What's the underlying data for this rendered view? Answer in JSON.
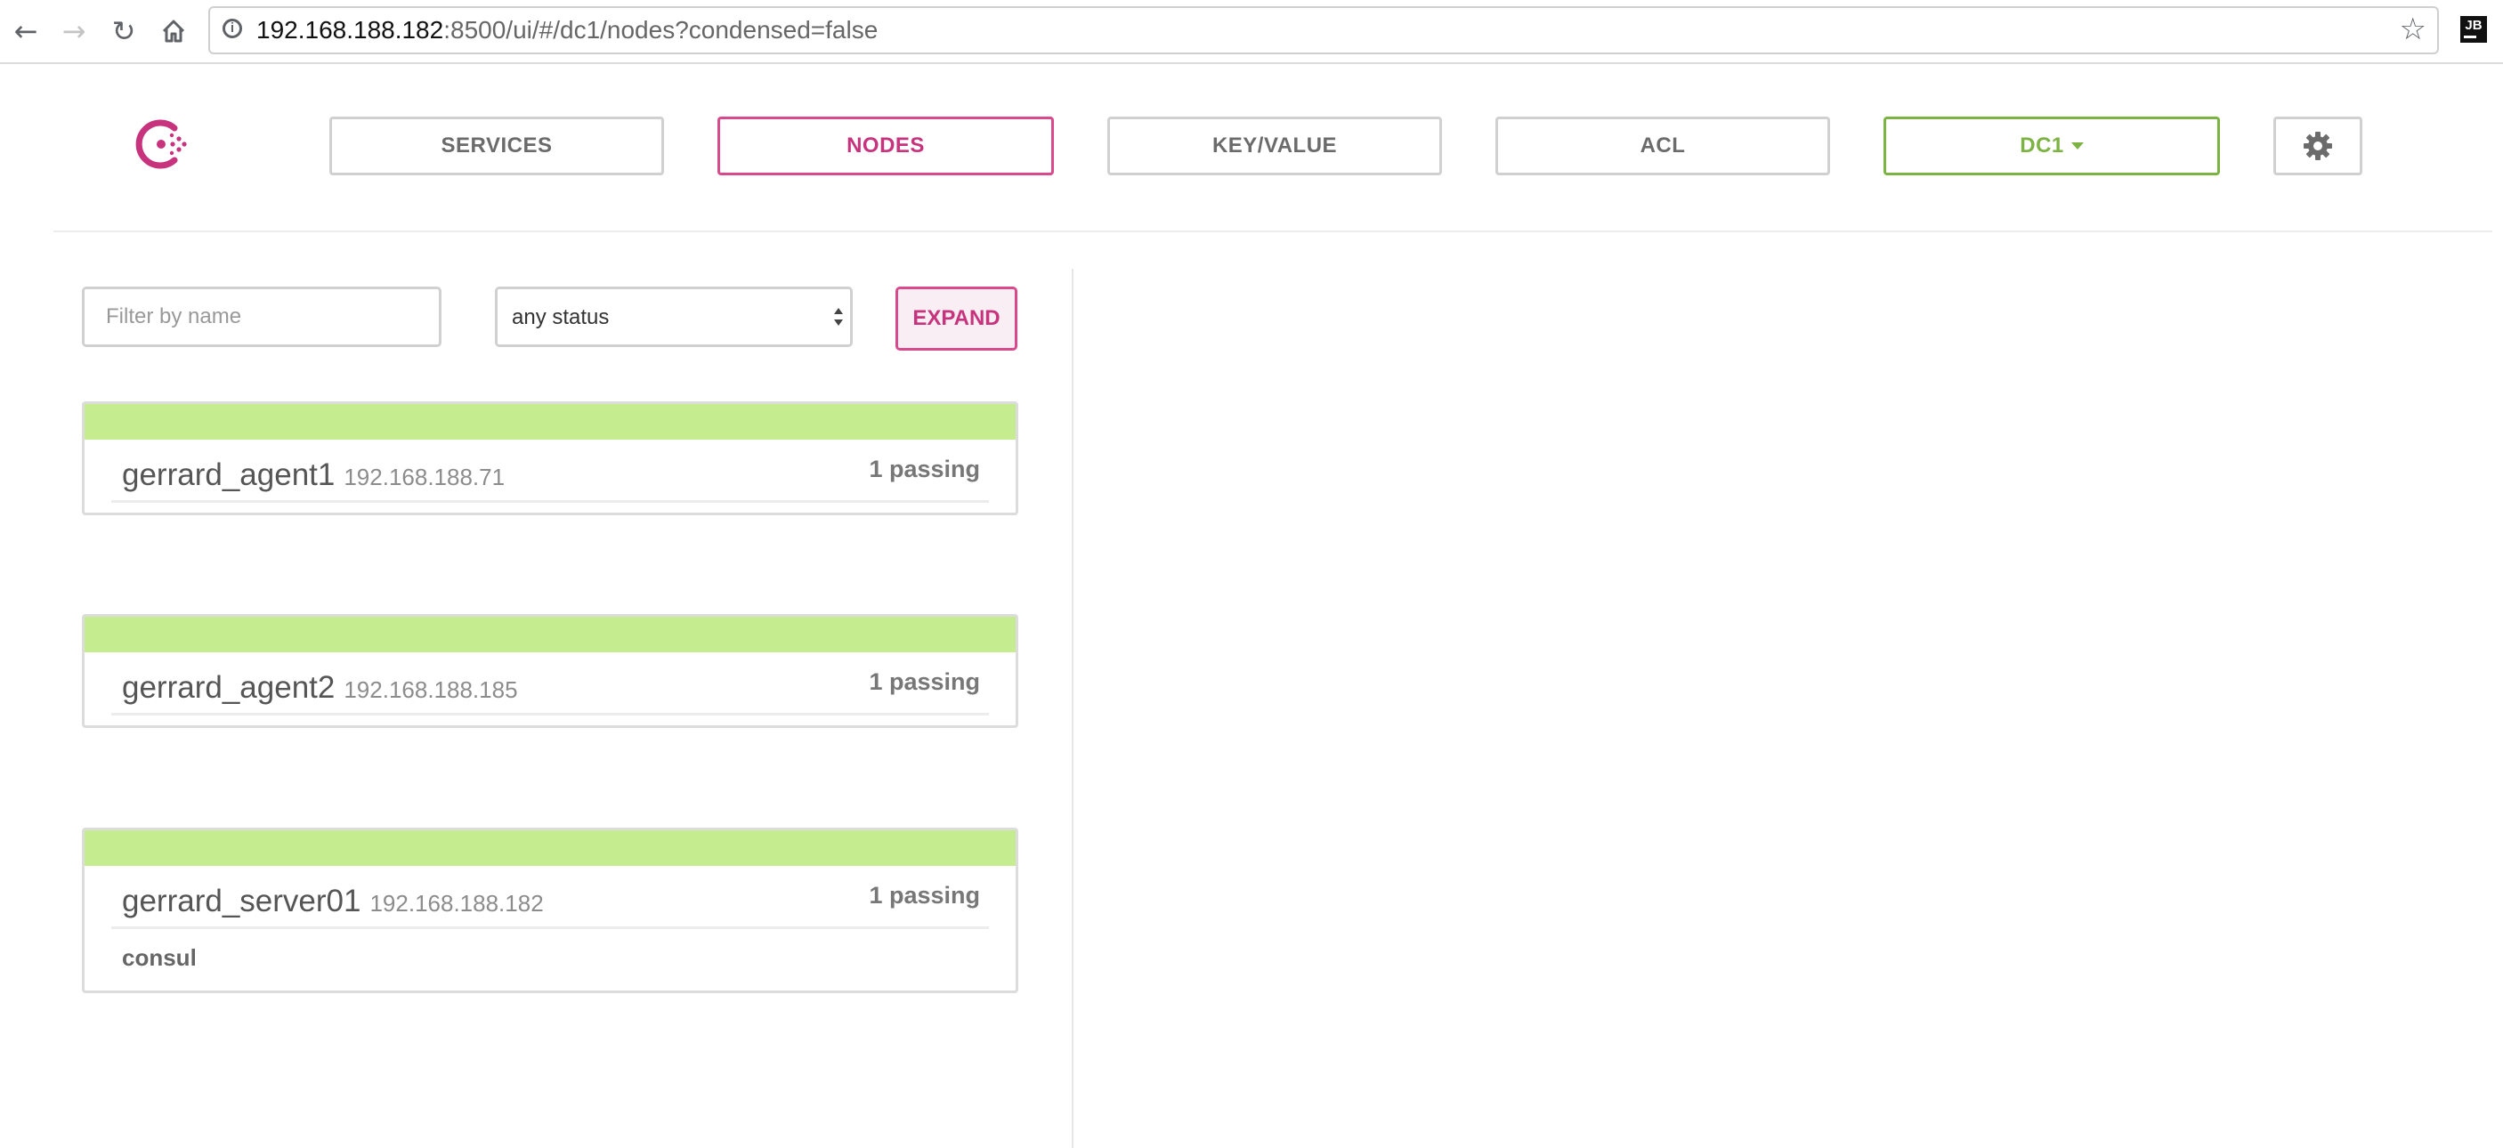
{
  "browser": {
    "back_icon": "arrow-left-icon",
    "forward_icon": "arrow-right-icon",
    "reload_icon": "reload-icon",
    "home_icon": "home-icon",
    "url_host": "192.168.188.182",
    "url_rest": ":8500/ui/#/dc1/nodes?condensed=false",
    "star_icon": "star-icon",
    "extension_label": "JB"
  },
  "header": {
    "logo_icon": "consul-logo-icon",
    "nav": {
      "services": "SERVICES",
      "nodes": "NODES",
      "key_value": "KEY/VALUE",
      "acl": "ACL",
      "datacenter": "DC1"
    },
    "settings_icon": "gear-icon"
  },
  "filters": {
    "name_placeholder": "Filter by name",
    "name_value": "",
    "status_selected": "any status",
    "expand_label": "EXPAND"
  },
  "nodes": [
    {
      "name": "gerrard_agent1",
      "address": "192.168.188.71",
      "checks": "1 passing",
      "services": []
    },
    {
      "name": "gerrard_agent2",
      "address": "192.168.188.185",
      "checks": "1 passing",
      "services": []
    },
    {
      "name": "gerrard_server01",
      "address": "192.168.188.182",
      "checks": "1 passing",
      "services": [
        "consul"
      ]
    }
  ],
  "colors": {
    "accent_pink": "#c7337c",
    "accent_green": "#7cb342",
    "health_passing": "#c5ec8e"
  }
}
